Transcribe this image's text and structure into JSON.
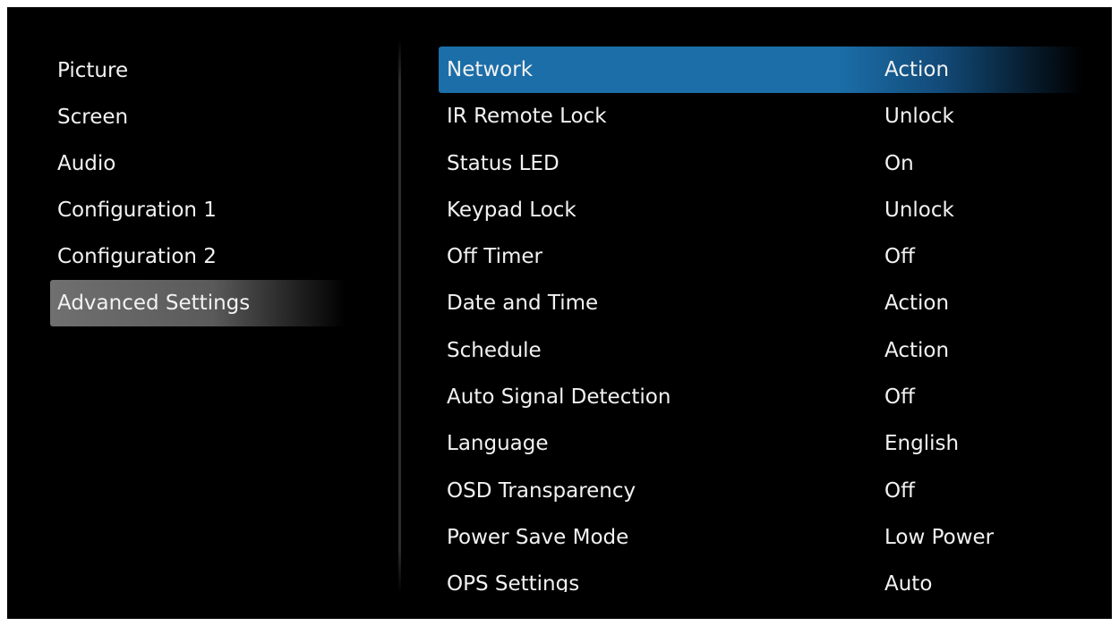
{
  "left_menu": {
    "items": [
      {
        "label": "Picture"
      },
      {
        "label": "Screen"
      },
      {
        "label": "Audio"
      },
      {
        "label": "Configuration 1"
      },
      {
        "label": "Configuration 2"
      },
      {
        "label": "Advanced Settings"
      }
    ],
    "selected": "Advanced Settings"
  },
  "settings": {
    "rows": [
      {
        "label": "Network",
        "value": "Action"
      },
      {
        "label": "IR Remote Lock",
        "value": "Unlock"
      },
      {
        "label": "Status LED",
        "value": "On"
      },
      {
        "label": "Keypad Lock",
        "value": "Unlock"
      },
      {
        "label": "Off Timer",
        "value": "Off"
      },
      {
        "label": "Date and Time",
        "value": "Action"
      },
      {
        "label": "Schedule",
        "value": "Action"
      },
      {
        "label": "Auto Signal Detection",
        "value": "Off"
      },
      {
        "label": "Language",
        "value": "English"
      },
      {
        "label": "OSD Transparency",
        "value": "Off"
      },
      {
        "label": "Power Save Mode",
        "value": "Low Power"
      },
      {
        "label": "OPS Settings",
        "value": "Auto"
      }
    ],
    "selected": "Network"
  },
  "colors": {
    "background": "#000000",
    "text": "#f2f2f2",
    "left_highlight": "#6a6a6a",
    "right_highlight": "#1b6ea8"
  }
}
